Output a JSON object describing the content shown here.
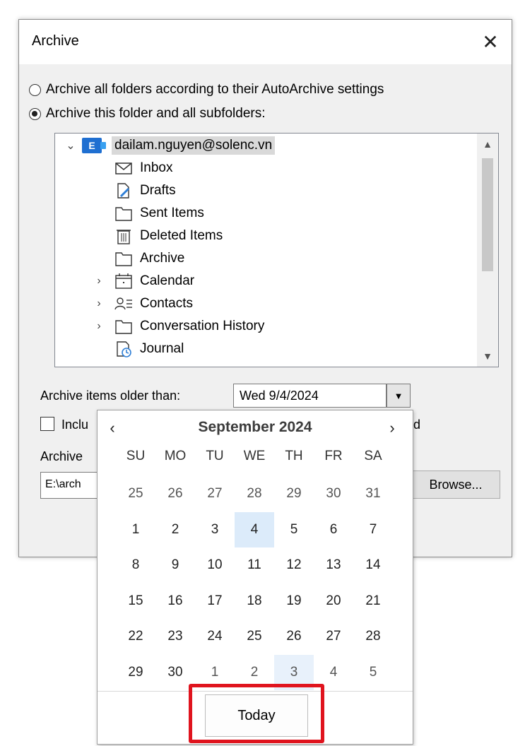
{
  "dialog": {
    "title": "Archive",
    "close_icon": "✕",
    "option_all": "Archive all folders according to their AutoArchive settings",
    "option_this": "Archive this folder and all subfolders:",
    "root_account": "dailam.nguyen@solenc.vn",
    "folders": [
      {
        "name": "Inbox",
        "icon": "envelope-icon",
        "expandable": false
      },
      {
        "name": "Drafts",
        "icon": "drafts-icon",
        "expandable": false
      },
      {
        "name": "Sent Items",
        "icon": "folder-icon",
        "expandable": false
      },
      {
        "name": "Deleted Items",
        "icon": "trash-icon",
        "expandable": false
      },
      {
        "name": "Archive",
        "icon": "folder-icon",
        "expandable": false
      },
      {
        "name": "Calendar",
        "icon": "calendar-icon",
        "expandable": true
      },
      {
        "name": "Contacts",
        "icon": "contacts-icon",
        "expandable": true
      },
      {
        "name": "Conversation History",
        "icon": "folder-icon",
        "expandable": true
      },
      {
        "name": "Journal",
        "icon": "journal-icon",
        "expandable": false
      }
    ],
    "older_than_label": "Archive items older than:",
    "older_than_value": "Wed 9/4/2024",
    "include_fragment": "Inclu",
    "right_fragment": "d",
    "archive_file_fragment": "Archive",
    "path_fragment": "E:\\arch",
    "browse_label": "Browse..."
  },
  "calendar": {
    "month_label": "September 2024",
    "prev_icon": "‹",
    "next_icon": "›",
    "weekdays": [
      "SU",
      "MO",
      "TU",
      "WE",
      "TH",
      "FR",
      "SA"
    ],
    "days": [
      {
        "d": "25",
        "other": true
      },
      {
        "d": "26",
        "other": true
      },
      {
        "d": "27",
        "other": true
      },
      {
        "d": "28",
        "other": true
      },
      {
        "d": "29",
        "other": true
      },
      {
        "d": "30",
        "other": true
      },
      {
        "d": "31",
        "other": true
      },
      {
        "d": "1"
      },
      {
        "d": "2"
      },
      {
        "d": "3"
      },
      {
        "d": "4",
        "selected": true
      },
      {
        "d": "5"
      },
      {
        "d": "6"
      },
      {
        "d": "7"
      },
      {
        "d": "8"
      },
      {
        "d": "9"
      },
      {
        "d": "10"
      },
      {
        "d": "11"
      },
      {
        "d": "12"
      },
      {
        "d": "13"
      },
      {
        "d": "14"
      },
      {
        "d": "15"
      },
      {
        "d": "16"
      },
      {
        "d": "17"
      },
      {
        "d": "18"
      },
      {
        "d": "19"
      },
      {
        "d": "20"
      },
      {
        "d": "21"
      },
      {
        "d": "22"
      },
      {
        "d": "23"
      },
      {
        "d": "24"
      },
      {
        "d": "25"
      },
      {
        "d": "26"
      },
      {
        "d": "27"
      },
      {
        "d": "28"
      },
      {
        "d": "29"
      },
      {
        "d": "30"
      },
      {
        "d": "1",
        "other": true
      },
      {
        "d": "2",
        "other": true
      },
      {
        "d": "3",
        "other": true,
        "today": true
      },
      {
        "d": "4",
        "other": true
      },
      {
        "d": "5",
        "other": true
      }
    ],
    "today_label": "Today"
  },
  "colors": {
    "accent": "#1f6fd1",
    "highlight": "#e0141e",
    "selected_day": "#dcebfa"
  }
}
